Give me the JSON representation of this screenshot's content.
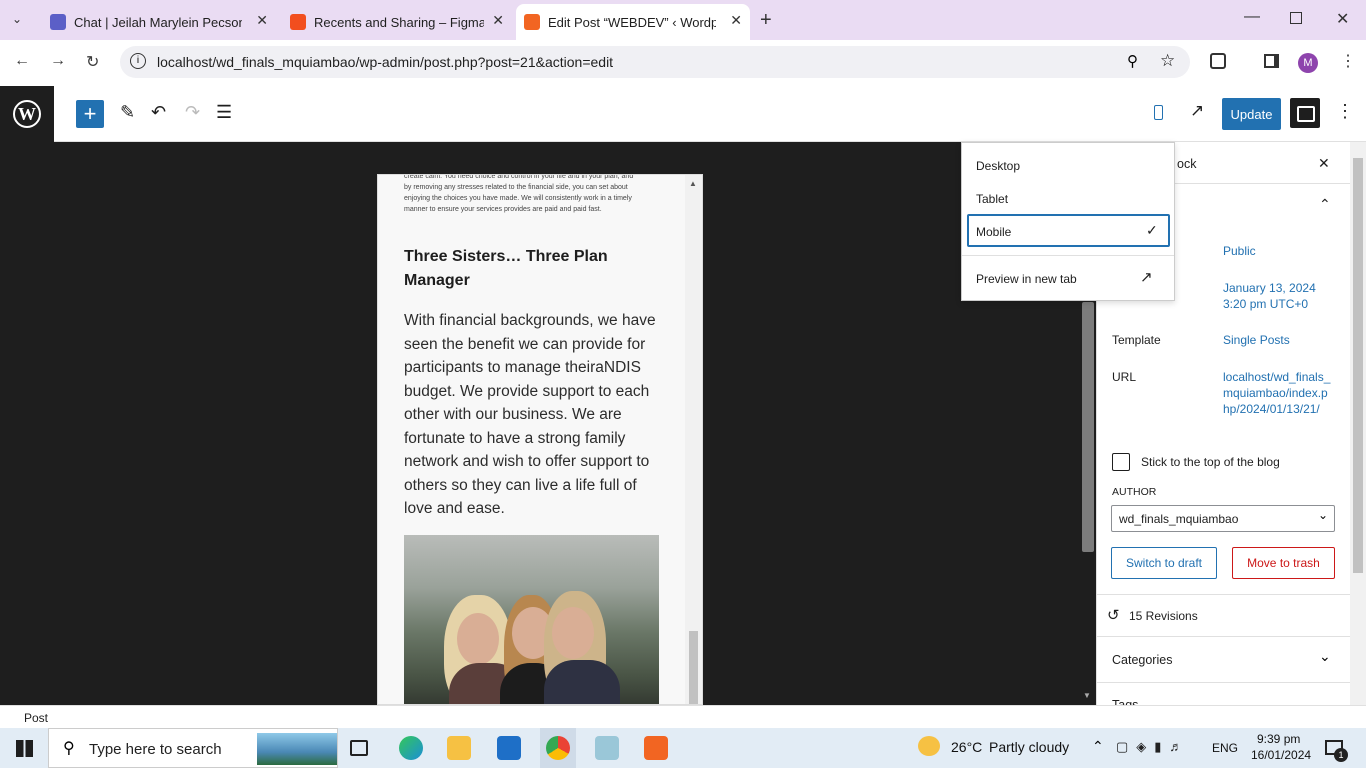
{
  "browser": {
    "tabs": [
      {
        "title": "Chat | Jeilah Marylein Pecson | M",
        "color": "#5b5fc7"
      },
      {
        "title": "Recents and Sharing – Figma",
        "color": "#f24e1e"
      },
      {
        "title": "Edit Post “WEBDEV” ‹ Wordpres",
        "color": "#f26522"
      }
    ],
    "url": "localhost/wd_finals_mquiambao/wp-admin/post.php?post=21&action=edit",
    "profile_initial": "M"
  },
  "editor": {
    "update_label": "Update",
    "post_small_text": "create calm. You need choice and control in your life and in your plan, and by removing any stresses related to the financial side, you can set about enjoying the choices you have made. We will consistently work in a timely manner to ensure your services provides are paid and paid fast.",
    "heading": "Three Sisters… Three Plan Manager",
    "paragraph": "With financial backgrounds, we have seen the benefit we can provide for participants to manage theiraNDIS budget. We provide support to each other with our business. We are fortunate to have a strong family network and wish to offer support to others so they can live a life full of love and ease."
  },
  "preview_menu": {
    "items": [
      "Desktop",
      "Tablet",
      "Mobile"
    ],
    "selected": "Mobile",
    "preview_new_tab": "Preview in new tab"
  },
  "sidebar": {
    "tab_partial": "ock",
    "visibility_value": "Public",
    "publish_date": "January 13, 2024",
    "publish_time": "3:20 pm UTC+0",
    "template_label": "Template",
    "template_value": "Single Posts",
    "url_label": "URL",
    "url_value": "localhost/wd_finals_mquiambao/index.php/2024/01/13/21/",
    "sticky_label": "Stick to the top of the blog",
    "author_label": "AUTHOR",
    "author_value": "wd_finals_mquiambao",
    "switch_draft": "Switch to draft",
    "move_trash": "Move to trash",
    "revisions": "15 Revisions",
    "categories": "Categories",
    "tags_partial": "Tags"
  },
  "status_bar": {
    "breadcrumb": "Post"
  },
  "taskbar": {
    "search_placeholder": "Type here to search",
    "weather_temp": "26°C",
    "weather_desc": "Partly cloudy",
    "lang": "ENG",
    "time": "9:39 pm",
    "date": "16/01/2024",
    "notif_count": "1"
  }
}
